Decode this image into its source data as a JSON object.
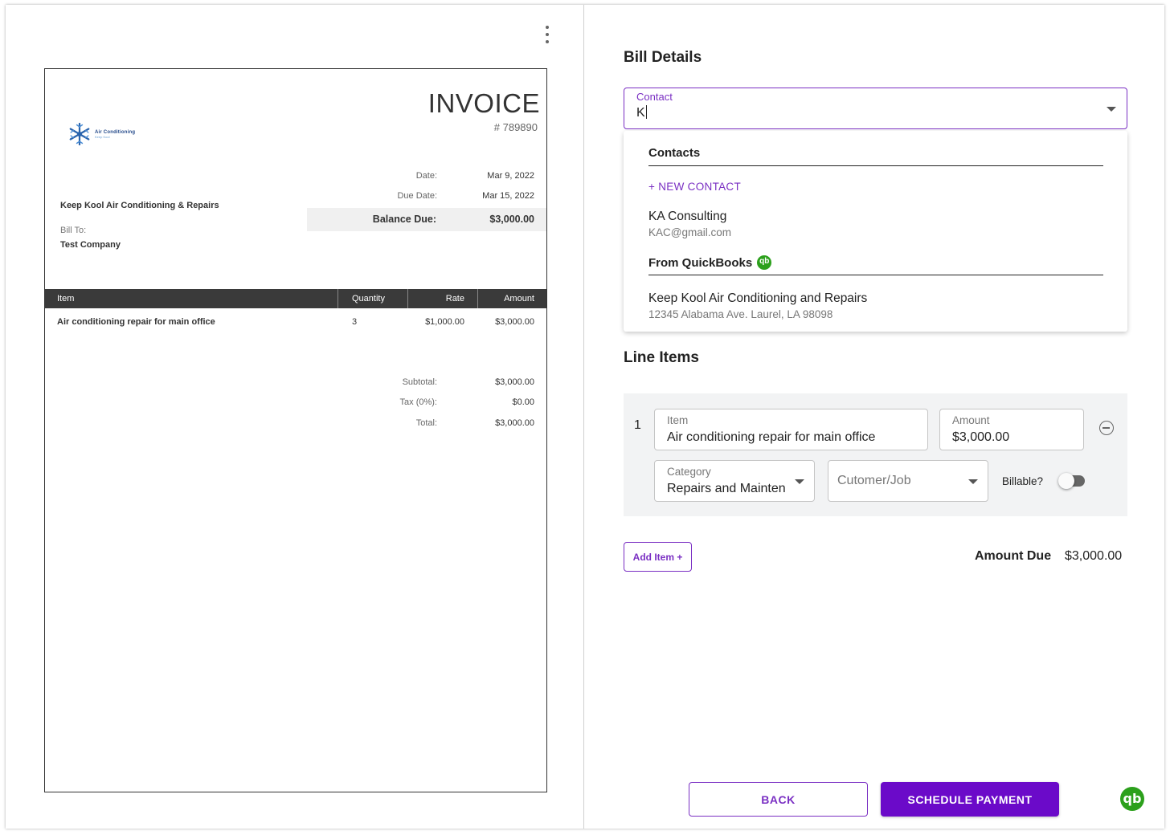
{
  "invoice": {
    "logo_text_1": "Air Conditioning",
    "logo_text_2": "Keep Kool",
    "title": "INVOICE",
    "number": "# 789890",
    "date_label": "Date:",
    "date_value": "Mar 9, 2022",
    "due_date_label": "Due Date:",
    "due_date_value": "Mar 15, 2022",
    "balance_label": "Balance Due:",
    "balance_value": "$3,000.00",
    "from_company": "Keep Kool Air Conditioning & Repairs",
    "bill_to_label": "Bill To:",
    "bill_to_value": "Test Company",
    "columns": [
      "Item",
      "Quantity",
      "Rate",
      "Amount"
    ],
    "rows": [
      {
        "item": "Air conditioning repair for main office",
        "quantity": "3",
        "rate": "$1,000.00",
        "amount": "$3,000.00"
      }
    ],
    "subtotal_label": "Subtotal:",
    "subtotal_value": "$3,000.00",
    "tax_label": "Tax (0%):",
    "tax_value": "$0.00",
    "total_label": "Total:",
    "total_value": "$3,000.00"
  },
  "bill_details": {
    "heading": "Bill Details",
    "contact_label": "Contact",
    "contact_value": "K",
    "menu": {
      "contacts_heading": "Contacts",
      "new_contact": "+ NEW CONTACT",
      "contacts": [
        {
          "name": "KA Consulting",
          "sub": "KAC@gmail.com"
        }
      ],
      "quickbooks_heading": "From QuickBooks",
      "quickbooks": [
        {
          "name": "Keep Kool Air Conditioning and Repairs",
          "sub": "12345 Alabama Ave. Laurel, LA 98098"
        }
      ]
    }
  },
  "line_items": {
    "heading": "Line Items",
    "items": [
      {
        "number": "1",
        "item_label": "Item",
        "item_value": "Air conditioning repair for main office",
        "amount_label": "Amount",
        "amount_value": "$3,000.00",
        "category_label": "Category",
        "category_value": "Repairs and Mainten",
        "customer_placeholder": "Cutomer/Job",
        "billable_label": "Billable?",
        "billable": false
      }
    ],
    "add_item_label": "Add Item +",
    "amount_due_label": "Amount Due",
    "amount_due_value": "$3,000.00"
  },
  "footer": {
    "back_label": "BACK",
    "primary_label": "SCHEDULE PAYMENT"
  },
  "colors": {
    "accent": "#6b0ac9",
    "quickbooks_green": "#2ca01c"
  },
  "icons": [
    "kebab-menu-icon",
    "snowflake-logo-icon",
    "dropdown-arrow-icon",
    "quickbooks-icon",
    "remove-circle-icon"
  ]
}
